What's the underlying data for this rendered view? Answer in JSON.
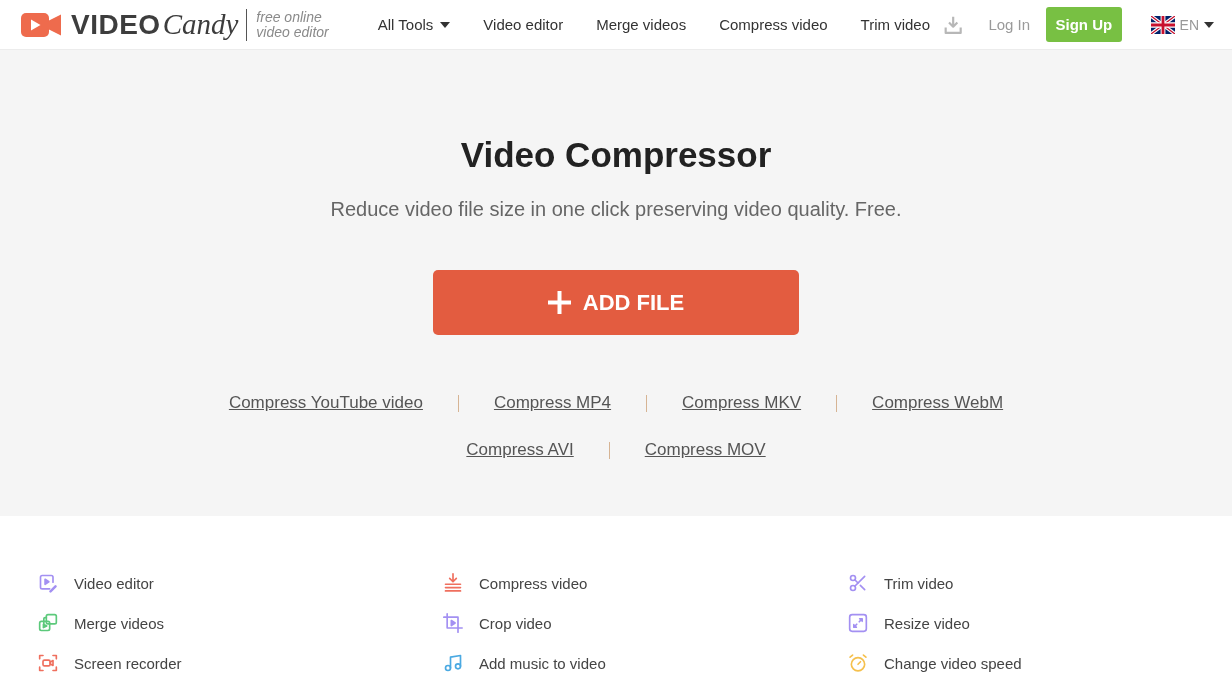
{
  "header": {
    "logo": {
      "wordmark": "VIDEO",
      "script": "Candy",
      "tagline": [
        "free online",
        "video editor"
      ]
    },
    "nav": [
      {
        "label": "All Tools",
        "kind": "dropdown"
      },
      {
        "label": "Video editor",
        "kind": "link"
      },
      {
        "label": "Merge videos",
        "kind": "link"
      },
      {
        "label": "Compress video",
        "kind": "link"
      },
      {
        "label": "Trim video",
        "kind": "link"
      }
    ],
    "login": "Log In",
    "signup": "Sign Up",
    "language": "EN"
  },
  "hero": {
    "title": "Video Compressor",
    "subtitle": "Reduce video file size in one click preserving video quality. Free.",
    "add_button": "ADD FILE",
    "format_links": [
      [
        "Compress YouTube video",
        "Compress MP4",
        "Compress MKV",
        "Compress WebM"
      ],
      [
        "Compress AVI",
        "Compress MOV"
      ]
    ]
  },
  "tools": [
    [
      "Video editor",
      "Merge videos",
      "Screen recorder"
    ],
    [
      "Compress video",
      "Crop video",
      "Add music to video"
    ],
    [
      "Trim video",
      "Resize video",
      "Change video speed"
    ]
  ]
}
